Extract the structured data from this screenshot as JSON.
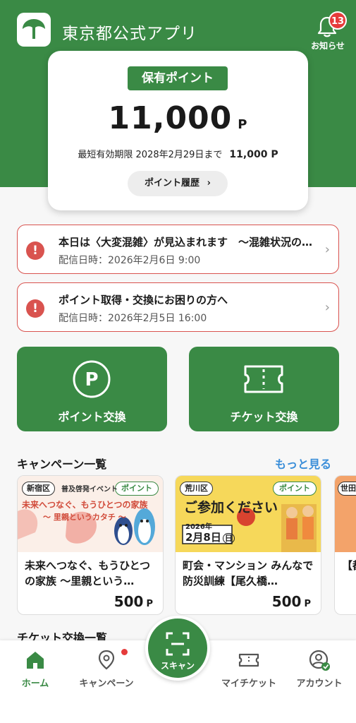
{
  "app": {
    "title": "東京都公式アプリ",
    "notifications": {
      "label": "お知らせ",
      "count": "13"
    }
  },
  "points": {
    "badge": "保有ポイント",
    "value": "11,000",
    "unit": "P",
    "expiry_label": "最短有効期限 2028年2月29日まで",
    "expiry_value": "11,000 P",
    "history_button": "ポイント履歴"
  },
  "alerts": [
    {
      "title": "本日は〈大変混雑〉が見込まれます　～混雑状況のお知らせ",
      "date": "配信日時：2026年2月6日 9:00"
    },
    {
      "title": "ポイント取得・交換にお困りの方へ",
      "date": "配信日時：2026年2月5日 16:00"
    }
  ],
  "actions": {
    "point_exchange": "ポイント交換",
    "ticket_exchange": "チケット交換"
  },
  "campaigns": {
    "title": "キャンペーン一覧",
    "more": "もっと見る",
    "items": [
      {
        "area": "新宿区",
        "tag": "ポイント",
        "img_line1": "普及啓発イベント",
        "img_line2": "未来へつなぐ、もうひとつの家族",
        "img_line3": "～ 里親というカタチ ～",
        "text": "未来へつなぐ、もうひとつの家族 ～里親という…",
        "points": "500",
        "unit": "P"
      },
      {
        "area": "荒川区",
        "tag": "ポイント",
        "img_line1": "ご参加ください",
        "img_date_year": "2026年",
        "img_date": "2月8日",
        "img_day": "日",
        "text": "町会・マンション みんなで防災訓練【尾久橋…",
        "points": "500",
        "unit": "P"
      },
      {
        "area": "世田",
        "text": "【都…",
        "points": "",
        "unit": ""
      }
    ]
  },
  "section2": {
    "title": "チケット交換一覧"
  },
  "nav": {
    "home": "ホーム",
    "campaign": "キャンペーン",
    "scan": "スキャン",
    "my_ticket": "マイチケット",
    "account": "アカウント"
  },
  "colors": {
    "brand": "#3a8a45",
    "alert": "#d9534f",
    "link": "#3a8ed9"
  }
}
